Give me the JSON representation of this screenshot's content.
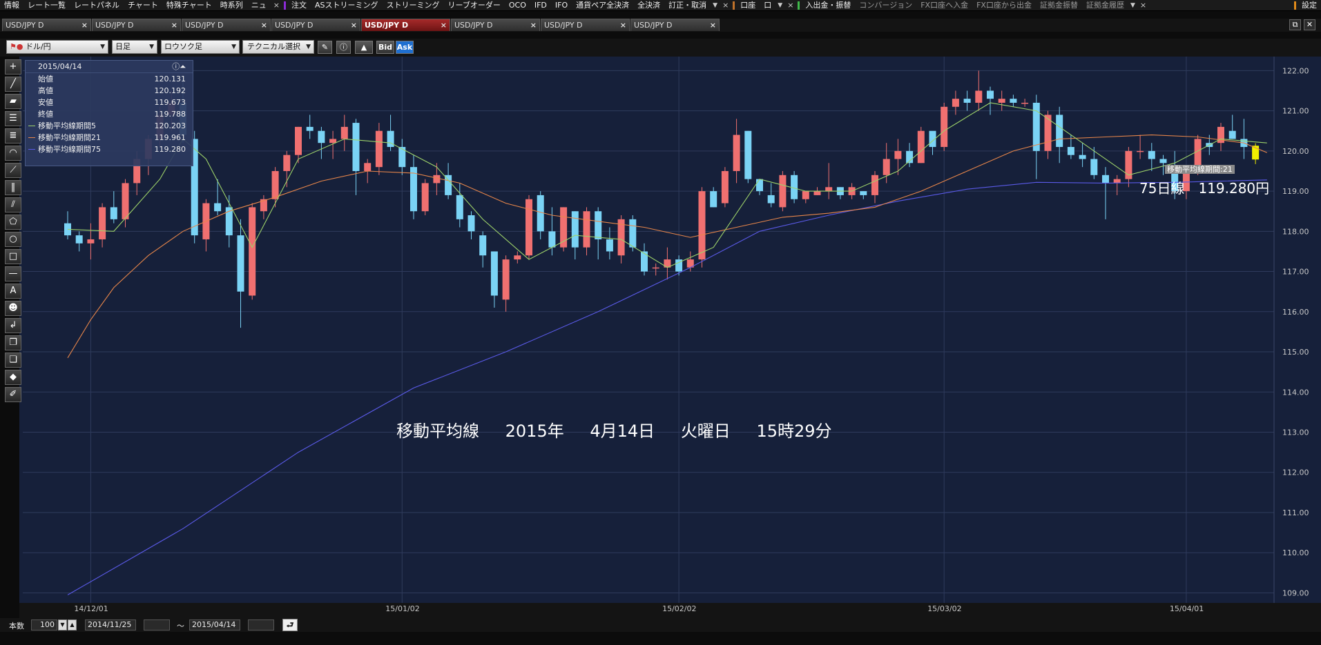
{
  "menu": {
    "group1": [
      "情報",
      "レート一覧",
      "レートパネル",
      "チャート",
      "特殊チャート",
      "時系列",
      "ニュ"
    ],
    "group2": [
      "注文",
      "ASストリーミング",
      "ストリーミング",
      "リーブオーダー",
      "OCO",
      "IFD",
      "IFO",
      "通貨ペア全決済",
      "全決済",
      "訂正・取消"
    ],
    "group3": [
      "口座",
      "口"
    ],
    "group4_main": "入出金・振替",
    "group4": [
      "コンバージョン",
      "FX口座へ入金",
      "FX口座から出金",
      "証拠金振替",
      "証拠金履歴"
    ],
    "settings": "設定",
    "sep_colors": [
      "#8c2bd6",
      "#c0722a",
      "#3fb84a",
      "#e08a1a"
    ]
  },
  "tabs": [
    {
      "label": "USD/JPY D",
      "active": false
    },
    {
      "label": "USD/JPY D",
      "active": false
    },
    {
      "label": "USD/JPY D",
      "active": false
    },
    {
      "label": "USD/JPY D",
      "active": false
    },
    {
      "label": "USD/JPY D",
      "active": true
    },
    {
      "label": "USD/JPY D",
      "active": false
    },
    {
      "label": "USD/JPY D",
      "active": false
    },
    {
      "label": "USD/JPY D",
      "active": false
    }
  ],
  "toolbar": {
    "pair": "ドル/円",
    "period": "日足",
    "chart_type": "ロウソク足",
    "technical": "テクニカル選択",
    "bid": "Bid",
    "ask": "Ask"
  },
  "ohlc": {
    "date": "2015/04/14",
    "rows": [
      {
        "label": "始値",
        "value": "120.131"
      },
      {
        "label": "高値",
        "value": "120.192"
      },
      {
        "label": "安値",
        "value": "119.673"
      },
      {
        "label": "終値",
        "value": "119.788"
      },
      {
        "label": "移動平均線期間5",
        "value": "120.203",
        "color": "#9ed36a"
      },
      {
        "label": "移動平均線期間21",
        "value": "119.961",
        "color": "#e8864a"
      },
      {
        "label": "移動平均線期間75",
        "value": "119.280",
        "color": "#5a5ae8"
      }
    ]
  },
  "overlay": {
    "ma_label": "移動平均線期間:21",
    "ma75_text": "75日線",
    "ma75_value": "119.280円",
    "caption_title": "移動平均線",
    "caption_year": "2015年",
    "caption_date": "4月14日",
    "caption_weekday": "火曜日",
    "caption_time": "15時29分"
  },
  "bottom": {
    "count_label": "本数",
    "count_value": "100",
    "from_date": "2014/11/25",
    "tilde": "～",
    "to_date": "2015/04/14"
  },
  "chart_data": {
    "type": "candlestick",
    "y_range": [
      108.75,
      122.35
    ],
    "y_ticks": [
      "122.00",
      "121.00",
      "120.00",
      "119.00",
      "118.00",
      "117.00",
      "116.00",
      "115.00",
      "114.00",
      "113.00",
      "112.00",
      "111.00",
      "110.00",
      "109.00"
    ],
    "x_ticks": [
      "14/12/01",
      "15/01/02",
      "15/02/02",
      "15/03/02",
      "15/04/01"
    ],
    "x_tick_index": [
      2,
      29,
      53,
      76,
      97
    ],
    "colors": {
      "up": "#f07070",
      "down": "#7ad3f5",
      "last": "#f0f000",
      "ma5": "#9ed36a",
      "ma21": "#e8864a",
      "ma75": "#5a5ae8"
    },
    "ohlc": [
      [
        118.2,
        118.5,
        117.8,
        117.9
      ],
      [
        117.9,
        118.0,
        117.5,
        117.7
      ],
      [
        117.7,
        118.2,
        117.3,
        117.8
      ],
      [
        117.8,
        118.7,
        117.6,
        118.6
      ],
      [
        118.6,
        119.0,
        118.2,
        118.3
      ],
      [
        118.3,
        119.3,
        118.1,
        119.2
      ],
      [
        119.2,
        120.0,
        118.9,
        119.8
      ],
      [
        119.8,
        120.4,
        119.4,
        120.3
      ],
      [
        120.3,
        121.1,
        120.1,
        120.9
      ],
      [
        120.9,
        121.5,
        120.5,
        121.2
      ],
      [
        121.2,
        121.8,
        120.2,
        120.4
      ],
      [
        120.3,
        120.5,
        117.7,
        117.9
      ],
      [
        117.8,
        118.8,
        117.5,
        118.7
      ],
      [
        118.7,
        119.3,
        118.4,
        118.5
      ],
      [
        118.6,
        118.9,
        117.6,
        117.9
      ],
      [
        117.9,
        118.3,
        115.6,
        116.5
      ],
      [
        116.4,
        118.7,
        116.3,
        118.6
      ],
      [
        118.5,
        118.9,
        118.3,
        118.8
      ],
      [
        118.8,
        119.6,
        118.6,
        119.5
      ],
      [
        119.5,
        120.0,
        119.1,
        119.9
      ],
      [
        119.9,
        120.6,
        119.7,
        120.6
      ],
      [
        120.6,
        120.9,
        120.3,
        120.5
      ],
      [
        120.5,
        120.6,
        119.8,
        120.2
      ],
      [
        120.2,
        120.5,
        119.8,
        120.3
      ],
      [
        120.3,
        120.9,
        120.0,
        120.6
      ],
      [
        120.7,
        120.8,
        118.9,
        119.5
      ],
      [
        119.5,
        119.8,
        119.2,
        119.7
      ],
      [
        119.6,
        120.7,
        119.4,
        120.5
      ],
      [
        120.5,
        120.9,
        120.0,
        120.1
      ],
      [
        120.1,
        120.3,
        119.4,
        119.6
      ],
      [
        119.6,
        119.9,
        118.3,
        118.5
      ],
      [
        118.5,
        119.3,
        118.4,
        119.2
      ],
      [
        119.2,
        119.7,
        118.9,
        119.4
      ],
      [
        119.4,
        119.7,
        118.8,
        118.9
      ],
      [
        118.9,
        119.2,
        118.1,
        118.3
      ],
      [
        118.4,
        118.5,
        117.8,
        118.0
      ],
      [
        117.9,
        118.0,
        117.1,
        117.4
      ],
      [
        117.5,
        117.5,
        116.1,
        116.4
      ],
      [
        116.3,
        117.4,
        116.0,
        117.3
      ],
      [
        117.3,
        117.5,
        117.2,
        117.4
      ],
      [
        117.4,
        118.9,
        117.3,
        118.8
      ],
      [
        118.9,
        119.0,
        117.8,
        118.0
      ],
      [
        118.0,
        118.6,
        117.4,
        117.6
      ],
      [
        117.6,
        118.6,
        117.5,
        118.6
      ],
      [
        118.5,
        118.5,
        117.3,
        117.6
      ],
      [
        117.6,
        118.6,
        117.4,
        118.5
      ],
      [
        118.5,
        118.6,
        117.3,
        117.8
      ],
      [
        117.8,
        118.1,
        117.3,
        117.5
      ],
      [
        117.4,
        118.4,
        117.2,
        118.3
      ],
      [
        118.3,
        118.4,
        117.5,
        117.6
      ],
      [
        117.5,
        117.7,
        116.9,
        117.0
      ],
      [
        117.1,
        117.2,
        116.9,
        117.1
      ],
      [
        117.1,
        117.6,
        116.8,
        117.3
      ],
      [
        117.3,
        117.4,
        116.9,
        117.0
      ],
      [
        117.1,
        117.5,
        117.0,
        117.3
      ],
      [
        117.3,
        119.1,
        117.1,
        119.0
      ],
      [
        119.0,
        119.1,
        118.6,
        118.6
      ],
      [
        118.7,
        119.6,
        118.6,
        119.5
      ],
      [
        119.5,
        120.8,
        119.2,
        120.4
      ],
      [
        120.5,
        120.5,
        119.2,
        119.3
      ],
      [
        119.3,
        119.3,
        118.9,
        119.0
      ],
      [
        118.9,
        119.2,
        118.6,
        118.7
      ],
      [
        118.6,
        119.5,
        118.5,
        119.4
      ],
      [
        119.4,
        119.5,
        118.7,
        118.8
      ],
      [
        118.8,
        119.0,
        118.7,
        119.0
      ],
      [
        118.9,
        119.1,
        118.9,
        119.0
      ],
      [
        119.0,
        119.7,
        118.8,
        119.1
      ],
      [
        119.1,
        119.1,
        118.8,
        118.9
      ],
      [
        118.9,
        119.2,
        118.8,
        119.1
      ],
      [
        119.0,
        119.0,
        118.8,
        118.9
      ],
      [
        118.9,
        119.5,
        118.7,
        119.4
      ],
      [
        119.4,
        120.2,
        119.2,
        119.8
      ],
      [
        119.8,
        120.3,
        119.4,
        120.0
      ],
      [
        120.0,
        120.2,
        119.6,
        119.7
      ],
      [
        119.7,
        120.6,
        119.7,
        120.5
      ],
      [
        120.5,
        120.4,
        119.9,
        120.1
      ],
      [
        120.1,
        121.2,
        120.0,
        121.1
      ],
      [
        121.1,
        121.5,
        120.9,
        121.3
      ],
      [
        121.3,
        121.5,
        121.0,
        121.2
      ],
      [
        121.2,
        122.0,
        121.0,
        121.5
      ],
      [
        121.5,
        121.6,
        120.9,
        121.3
      ],
      [
        121.2,
        121.5,
        121.0,
        121.3
      ],
      [
        121.3,
        121.4,
        121.1,
        121.2
      ],
      [
        121.2,
        121.3,
        121.1,
        121.2
      ],
      [
        121.2,
        121.4,
        119.3,
        120.0
      ],
      [
        120.0,
        121.0,
        119.8,
        120.9
      ],
      [
        120.9,
        121.1,
        119.7,
        120.1
      ],
      [
        120.1,
        120.4,
        119.8,
        119.9
      ],
      [
        119.9,
        120.2,
        119.6,
        119.8
      ],
      [
        119.8,
        120.1,
        119.3,
        119.4
      ],
      [
        119.4,
        119.6,
        118.3,
        119.2
      ],
      [
        119.2,
        119.4,
        118.9,
        119.3
      ],
      [
        119.3,
        120.1,
        119.1,
        120.0
      ],
      [
        120.0,
        120.4,
        119.8,
        120.0
      ],
      [
        120.0,
        120.2,
        119.5,
        119.8
      ],
      [
        119.8,
        119.9,
        119.4,
        119.7
      ],
      [
        119.6,
        120.0,
        118.8,
        119.0
      ],
      [
        119.0,
        119.6,
        118.8,
        119.5
      ],
      [
        119.5,
        120.4,
        119.4,
        120.3
      ],
      [
        120.2,
        120.4,
        119.9,
        120.1
      ],
      [
        120.2,
        120.7,
        120.0,
        120.6
      ],
      [
        120.5,
        120.9,
        120.3,
        120.3
      ],
      [
        120.3,
        120.8,
        119.8,
        120.1
      ],
      [
        120.131,
        120.192,
        119.673,
        119.788
      ]
    ],
    "ma5": [
      [
        0,
        118.05
      ],
      [
        4,
        118.0
      ],
      [
        8,
        119.3
      ],
      [
        10,
        120.3
      ],
      [
        12,
        119.8
      ],
      [
        16,
        117.6
      ],
      [
        20,
        119.8
      ],
      [
        24,
        120.3
      ],
      [
        28,
        120.2
      ],
      [
        32,
        119.6
      ],
      [
        36,
        118.3
      ],
      [
        40,
        117.3
      ],
      [
        44,
        117.9
      ],
      [
        48,
        117.8
      ],
      [
        52,
        117.1
      ],
      [
        56,
        117.6
      ],
      [
        60,
        119.3
      ],
      [
        64,
        119.0
      ],
      [
        68,
        119.0
      ],
      [
        72,
        119.5
      ],
      [
        76,
        120.5
      ],
      [
        80,
        121.2
      ],
      [
        84,
        121.0
      ],
      [
        88,
        120.2
      ],
      [
        92,
        119.4
      ],
      [
        96,
        119.7
      ],
      [
        100,
        120.3
      ],
      [
        104,
        120.2
      ]
    ],
    "ma21": [
      [
        0,
        114.85
      ],
      [
        2,
        115.8
      ],
      [
        4,
        116.6
      ],
      [
        7,
        117.4
      ],
      [
        10,
        118.0
      ],
      [
        14,
        118.5
      ],
      [
        18,
        118.85
      ],
      [
        22,
        119.25
      ],
      [
        26,
        119.5
      ],
      [
        30,
        119.45
      ],
      [
        34,
        119.2
      ],
      [
        38,
        118.7
      ],
      [
        42,
        118.4
      ],
      [
        46,
        118.25
      ],
      [
        50,
        118.1
      ],
      [
        54,
        117.85
      ],
      [
        58,
        118.1
      ],
      [
        62,
        118.35
      ],
      [
        66,
        118.45
      ],
      [
        70,
        118.6
      ],
      [
        74,
        119.0
      ],
      [
        78,
        119.5
      ],
      [
        82,
        120.0
      ],
      [
        86,
        120.3
      ],
      [
        90,
        120.35
      ],
      [
        94,
        120.4
      ],
      [
        98,
        120.35
      ],
      [
        102,
        120.2
      ],
      [
        104,
        119.96
      ]
    ],
    "ma75": [
      [
        0,
        108.95
      ],
      [
        10,
        110.6
      ],
      [
        20,
        112.5
      ],
      [
        30,
        114.1
      ],
      [
        38,
        115.0
      ],
      [
        46,
        116.0
      ],
      [
        54,
        117.1
      ],
      [
        60,
        118.0
      ],
      [
        66,
        118.4
      ],
      [
        72,
        118.75
      ],
      [
        78,
        119.05
      ],
      [
        84,
        119.22
      ],
      [
        90,
        119.2
      ],
      [
        96,
        119.22
      ],
      [
        104,
        119.28
      ]
    ]
  }
}
